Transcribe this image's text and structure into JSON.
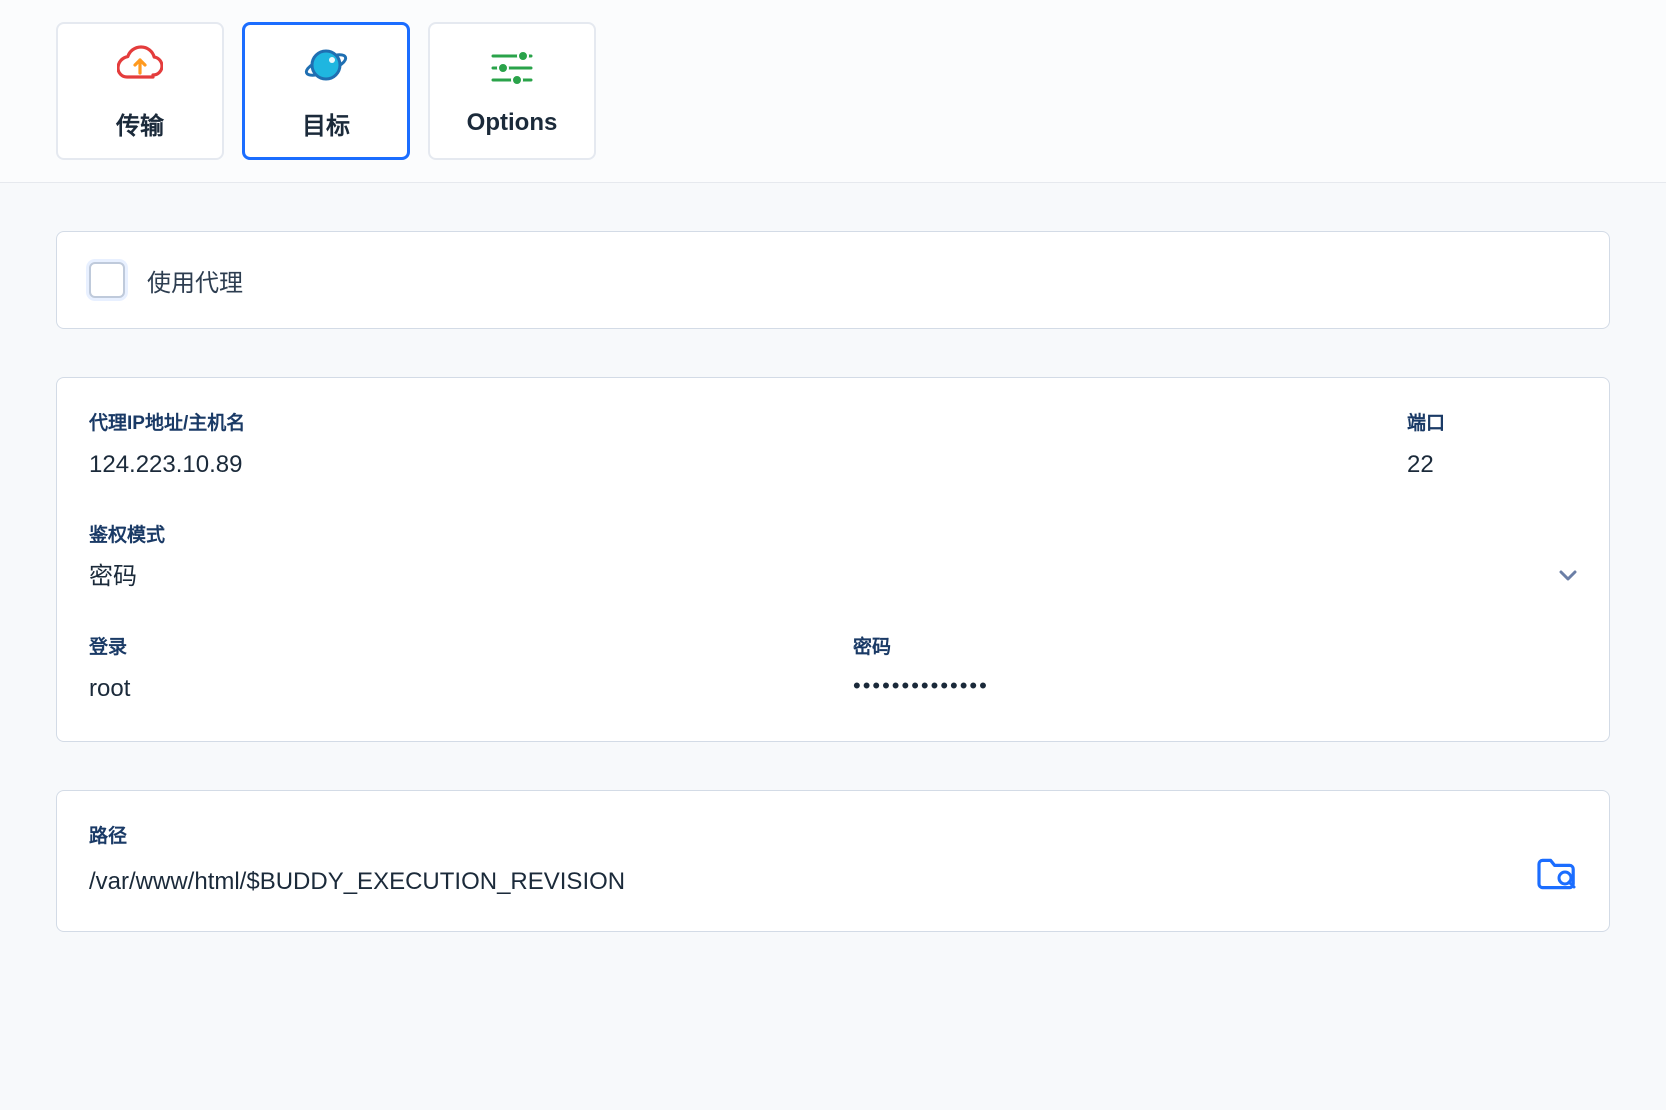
{
  "tabs": {
    "transfer": {
      "label": "传输"
    },
    "target": {
      "label": "目标"
    },
    "options": {
      "label": "Options"
    }
  },
  "proxy": {
    "use_proxy_label": "使用代理"
  },
  "server": {
    "host_label": "代理IP地址/主机名",
    "host_value": "124.223.10.89",
    "port_label": "端口",
    "port_value": "22",
    "auth_mode_label": "鉴权模式",
    "auth_mode_value": "密码",
    "login_label": "登录",
    "login_value": "root",
    "password_label": "密码",
    "password_value": "••••••••••••••"
  },
  "path": {
    "label": "路径",
    "value": "/var/www/html/$BUDDY_EXECUTION_REVISION"
  },
  "icons": {
    "transfer": "cloud-upload-icon",
    "target": "planet-icon",
    "options": "sliders-icon",
    "browse": "browse-folder-icon",
    "chevron": "chevron-down-icon"
  }
}
